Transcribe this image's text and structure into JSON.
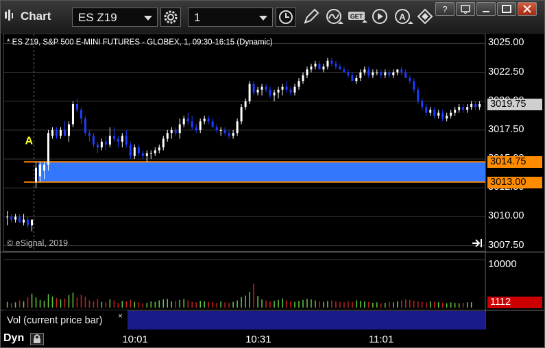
{
  "window": {
    "title": "Chart",
    "symbol": "ES Z19",
    "interval": "1"
  },
  "chart": {
    "info_label": "* ES Z19, S&P 500 E-MINI FUTURES - GLOBEX, 1, 09:30-16:15 (Dynamic)",
    "copyright": "© eSignal, 2019",
    "marker_label": "A",
    "price_ticks": [
      "3025.00",
      "3022.50",
      "3020.00",
      "3017.50",
      "3015.00",
      "3012.50",
      "3010.00",
      "3007.50"
    ],
    "current_price": "3019.75",
    "zone_top_price": "3014.75",
    "zone_bottom_price": "3013.00",
    "colors": {
      "up": "#ffffff",
      "down": "#1e3cff",
      "zone_fill": "#3377ff",
      "zone_line": "#ff8800",
      "grid": "#3a3a3a"
    }
  },
  "volume": {
    "label": "Vol (current price bar)",
    "close_symbol": "×",
    "tick": "10000",
    "current_value": "1112"
  },
  "time_axis": {
    "ticks": [
      "10:01",
      "10:31",
      "11:01"
    ]
  },
  "status": {
    "mode": "Dyn"
  },
  "chart_data": {
    "type": "candlestick",
    "y_range": [
      3007.0,
      3025.5
    ],
    "zone": {
      "from": 3013.0,
      "to": 3014.75
    },
    "candles": [
      [
        3010.0,
        3010.5,
        3009.25,
        3010.0
      ],
      [
        3010.0,
        3010.25,
        3009.5,
        3009.75
      ],
      [
        3009.75,
        3010.25,
        3009.5,
        3010.0
      ],
      [
        3010.0,
        3010.25,
        3009.5,
        3009.5
      ],
      [
        3009.5,
        3010.25,
        3009.25,
        3009.75
      ],
      [
        3009.75,
        3010.0,
        3009.0,
        3009.25
      ],
      [
        3009.25,
        3009.75,
        3008.75,
        3009.75
      ],
      [
        3013.0,
        3014.75,
        3012.5,
        3014.25
      ],
      [
        3013.5,
        3014.75,
        3013.0,
        3014.5
      ],
      [
        3014.0,
        3014.75,
        3013.25,
        3014.5
      ],
      [
        3014.5,
        3017.5,
        3014.0,
        3017.25
      ],
      [
        3017.0,
        3017.75,
        3016.75,
        3017.5
      ],
      [
        3017.5,
        3017.75,
        3016.75,
        3017.0
      ],
      [
        3017.0,
        3017.75,
        3016.75,
        3017.5
      ],
      [
        3017.5,
        3018.25,
        3017.0,
        3017.0
      ],
      [
        3017.0,
        3018.25,
        3016.5,
        3018.0
      ],
      [
        3018.0,
        3020.0,
        3017.75,
        3019.75
      ],
      [
        3019.75,
        3020.25,
        3019.0,
        3019.25
      ],
      [
        3019.25,
        3019.5,
        3018.0,
        3018.5
      ],
      [
        3018.5,
        3018.75,
        3017.0,
        3017.25
      ],
      [
        3017.25,
        3017.5,
        3016.5,
        3017.0
      ],
      [
        3017.0,
        3017.25,
        3016.0,
        3016.25
      ],
      [
        3016.25,
        3016.5,
        3015.5,
        3016.0
      ],
      [
        3016.0,
        3016.75,
        3015.75,
        3016.5
      ],
      [
        3016.5,
        3017.0,
        3015.75,
        3016.25
      ],
      [
        3016.25,
        3017.75,
        3016.0,
        3017.0
      ],
      [
        3017.0,
        3017.75,
        3016.5,
        3016.75
      ],
      [
        3016.75,
        3017.0,
        3016.0,
        3016.5
      ],
      [
        3016.5,
        3017.25,
        3016.0,
        3017.0
      ],
      [
        3017.0,
        3017.5,
        3016.0,
        3016.25
      ],
      [
        3016.25,
        3016.5,
        3015.0,
        3015.25
      ],
      [
        3015.25,
        3016.25,
        3015.0,
        3016.0
      ],
      [
        3016.0,
        3016.25,
        3015.25,
        3015.5
      ],
      [
        3015.5,
        3015.75,
        3015.0,
        3015.25
      ],
      [
        3015.25,
        3015.75,
        3014.75,
        3015.5
      ],
      [
        3015.5,
        3015.75,
        3015.0,
        3015.5
      ],
      [
        3015.5,
        3016.0,
        3015.25,
        3015.75
      ],
      [
        3015.75,
        3016.25,
        3015.5,
        3016.0
      ],
      [
        3016.0,
        3017.0,
        3015.75,
        3016.75
      ],
      [
        3016.75,
        3017.5,
        3016.5,
        3017.25
      ],
      [
        3017.25,
        3017.75,
        3016.75,
        3017.5
      ],
      [
        3017.5,
        3017.75,
        3017.0,
        3017.25
      ],
      [
        3017.25,
        3018.5,
        3016.75,
        3018.0
      ],
      [
        3018.0,
        3018.75,
        3017.75,
        3018.5
      ],
      [
        3018.5,
        3019.0,
        3018.0,
        3018.25
      ],
      [
        3018.25,
        3018.75,
        3017.5,
        3017.75
      ],
      [
        3017.75,
        3018.0,
        3017.25,
        3017.5
      ],
      [
        3017.5,
        3018.5,
        3017.25,
        3018.25
      ],
      [
        3018.25,
        3018.75,
        3018.0,
        3018.5
      ],
      [
        3018.5,
        3018.75,
        3018.0,
        3018.25
      ],
      [
        3018.25,
        3018.5,
        3017.75,
        3017.75
      ],
      [
        3017.75,
        3018.0,
        3017.25,
        3017.5
      ],
      [
        3017.5,
        3017.75,
        3017.0,
        3017.5
      ],
      [
        3017.5,
        3017.75,
        3017.0,
        3017.25
      ],
      [
        3017.25,
        3017.5,
        3016.75,
        3017.0
      ],
      [
        3017.0,
        3017.5,
        3016.75,
        3017.25
      ],
      [
        3017.25,
        3018.5,
        3017.0,
        3018.25
      ],
      [
        3018.25,
        3019.75,
        3018.0,
        3019.5
      ],
      [
        3019.5,
        3020.25,
        3019.25,
        3020.0
      ],
      [
        3020.0,
        3021.75,
        3019.75,
        3021.5
      ],
      [
        3021.5,
        3021.75,
        3020.5,
        3020.75
      ],
      [
        3020.75,
        3021.25,
        3020.5,
        3021.0
      ],
      [
        3021.0,
        3021.5,
        3020.5,
        3021.25
      ],
      [
        3021.25,
        3021.5,
        3020.75,
        3021.0
      ],
      [
        3021.0,
        3021.25,
        3020.25,
        3020.5
      ],
      [
        3020.5,
        3021.0,
        3020.0,
        3020.75
      ],
      [
        3020.75,
        3021.25,
        3020.25,
        3021.0
      ],
      [
        3021.0,
        3021.5,
        3020.5,
        3021.25
      ],
      [
        3021.25,
        3021.75,
        3020.75,
        3021.0
      ],
      [
        3021.0,
        3021.25,
        3020.5,
        3020.75
      ],
      [
        3020.75,
        3021.5,
        3020.5,
        3021.25
      ],
      [
        3021.25,
        3022.0,
        3021.0,
        3021.75
      ],
      [
        3021.75,
        3022.5,
        3021.5,
        3022.25
      ],
      [
        3022.25,
        3023.0,
        3022.0,
        3022.75
      ],
      [
        3022.75,
        3023.25,
        3022.5,
        3023.0
      ],
      [
        3023.0,
        3023.5,
        3022.75,
        3023.25
      ],
      [
        3023.25,
        3023.5,
        3022.75,
        3022.75
      ],
      [
        3022.75,
        3023.25,
        3022.5,
        3023.0
      ],
      [
        3023.0,
        3023.75,
        3022.75,
        3023.5
      ],
      [
        3023.5,
        3023.75,
        3023.0,
        3023.25
      ],
      [
        3023.25,
        3023.5,
        3022.75,
        3023.0
      ],
      [
        3023.0,
        3023.25,
        3022.75,
        3022.75
      ],
      [
        3022.75,
        3023.0,
        3022.5,
        3022.5
      ],
      [
        3022.5,
        3022.75,
        3022.0,
        3022.25
      ],
      [
        3022.25,
        3022.5,
        3021.75,
        3021.75
      ],
      [
        3021.75,
        3022.25,
        3021.5,
        3022.0
      ],
      [
        3022.0,
        3022.75,
        3021.75,
        3022.5
      ],
      [
        3022.5,
        3023.0,
        3022.25,
        3022.75
      ],
      [
        3022.75,
        3023.0,
        3022.0,
        3022.25
      ],
      [
        3022.25,
        3022.75,
        3022.0,
        3022.5
      ],
      [
        3022.5,
        3022.75,
        3022.25,
        3022.5
      ],
      [
        3022.5,
        3022.75,
        3022.0,
        3022.25
      ],
      [
        3022.25,
        3022.75,
        3022.0,
        3022.5
      ],
      [
        3022.5,
        3022.75,
        3022.0,
        3022.25
      ],
      [
        3022.25,
        3022.75,
        3022.0,
        3022.5
      ],
      [
        3022.5,
        3022.75,
        3022.25,
        3022.75
      ],
      [
        3022.75,
        3023.0,
        3022.25,
        3022.5
      ],
      [
        3022.5,
        3022.75,
        3022.0,
        3022.0
      ],
      [
        3022.0,
        3022.25,
        3021.5,
        3021.75
      ],
      [
        3021.75,
        3022.0,
        3020.75,
        3021.0
      ],
      [
        3021.0,
        3021.25,
        3019.75,
        3020.0
      ],
      [
        3020.0,
        3020.25,
        3019.25,
        3019.5
      ],
      [
        3019.5,
        3019.75,
        3018.75,
        3019.0
      ],
      [
        3019.0,
        3019.5,
        3018.75,
        3019.25
      ],
      [
        3019.25,
        3019.5,
        3018.5,
        3018.75
      ],
      [
        3018.75,
        3019.25,
        3018.5,
        3019.0
      ],
      [
        3019.0,
        3019.25,
        3018.25,
        3018.5
      ],
      [
        3018.5,
        3019.0,
        3018.25,
        3018.75
      ],
      [
        3018.75,
        3019.25,
        3018.5,
        3019.0
      ],
      [
        3019.0,
        3019.5,
        3018.75,
        3019.25
      ],
      [
        3019.25,
        3019.75,
        3019.0,
        3019.5
      ],
      [
        3019.5,
        3019.75,
        3019.0,
        3019.25
      ],
      [
        3019.25,
        3019.75,
        3019.0,
        3019.5
      ],
      [
        3019.5,
        3020.0,
        3019.25,
        3019.75
      ],
      [
        3019.75,
        3020.0,
        3019.25,
        3019.5
      ],
      [
        3019.5,
        3020.0,
        3019.25,
        3019.75
      ]
    ],
    "volume": [
      1200,
      900,
      1100,
      1500,
      1300,
      2200,
      2900,
      2100,
      1600,
      1400,
      2800,
      2300,
      2000,
      1700,
      1900,
      2600,
      3100,
      2100,
      2700,
      2300,
      1500,
      1300,
      1800,
      1200,
      1100,
      1700,
      1500,
      1000,
      1400,
      1300,
      1600,
      1200,
      1100,
      900,
      1000,
      1300,
      1200,
      1500,
      1700,
      1800,
      1300,
      1400,
      1600,
      1800,
      1500,
      1200,
      1100,
      1400,
      1300,
      1200,
      1100,
      1000,
      1300,
      1100,
      1000,
      1200,
      1500,
      2200,
      2500,
      3300,
      5000,
      2400,
      1700,
      1500,
      1300,
      1400,
      1600,
      1900,
      1500,
      1300,
      1200,
      1400,
      1600,
      1800,
      1700,
      1500,
      1300,
      1200,
      1400,
      1500,
      1300,
      1200,
      1100,
      1300,
      1200,
      1500,
      1400,
      1300,
      1200,
      1000,
      1100,
      900,
      1000,
      1200,
      1100,
      1300,
      1500,
      1700,
      1600,
      1400,
      1300,
      1200,
      1100,
      1300,
      1200,
      1100,
      1000,
      900,
      1100,
      1000,
      900,
      1000,
      1100,
      1112
    ]
  }
}
